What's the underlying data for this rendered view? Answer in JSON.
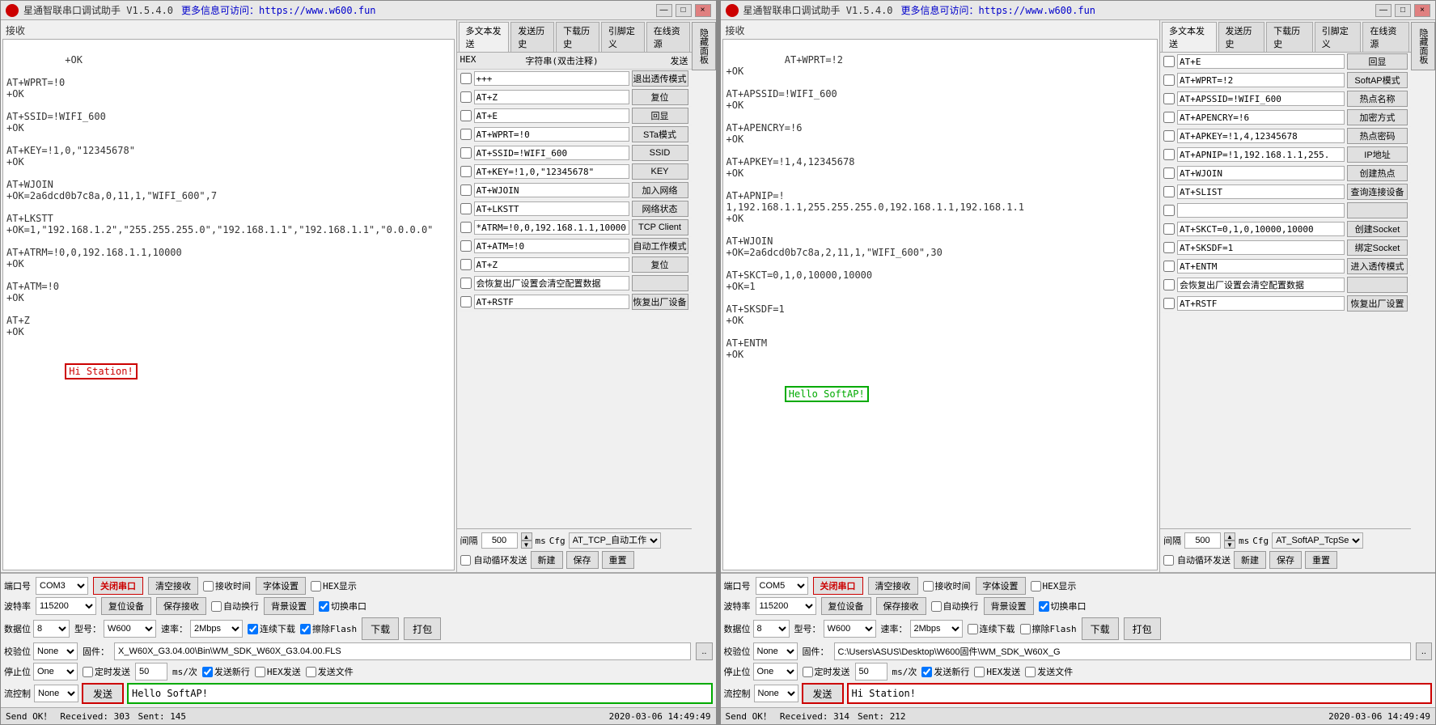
{
  "window1": {
    "title": "星通智联串口调试助手 V1.5.4.0",
    "url": "更多信息可访问：https://www.w600.fun",
    "controls": [
      "—",
      "□",
      "×"
    ],
    "receive_label": "接收",
    "receive_content": "+OK\n\nAT+WPRT=!0\n+OK\n\nAT+SSID=!WIFI_600\n+OK\n\nAT+KEY=!1,0,\"12345678\"\n+OK\n\nAT+WJOIN\n+OK=2a6dcd0b7c8a,0,11,1,\"WIFI_600\",7\n\nAT+LKSTT\n+OK=1,\"192.168.1.2\",\"255.255.255.0\",\"192.168.1.1\",\"192.168.1.1\",\"0.0.0.0\"\n\nAT+ATRM=!0,0,192.168.1.1,10000\n+OK\n\nAT+ATM=!0\n+OK\n\nAT+Z\n+OK",
    "hi_station": "Hi Station!",
    "tabs": [
      "多文本发送",
      "发送历史",
      "下载历史",
      "引脚定义",
      "在线资源"
    ],
    "multi_send": {
      "header": {
        "hex": "HEX",
        "str": "字符串(双击注释)",
        "send": "发送"
      },
      "rows": [
        {
          "hex": false,
          "value": "+++",
          "btn": "退出透传模式"
        },
        {
          "hex": false,
          "value": "AT+Z",
          "btn": "复位"
        },
        {
          "hex": false,
          "value": "AT+E",
          "btn": "回显"
        },
        {
          "hex": false,
          "value": "AT+WPRT=!0",
          "btn": "STa模式"
        },
        {
          "hex": false,
          "value": "AT+SSID=!WIFI_600",
          "btn": "SSID"
        },
        {
          "hex": false,
          "value": "AT+KEY=!1,0,\"12345678\"",
          "btn": "KEY"
        },
        {
          "hex": false,
          "value": "AT+WJOIN",
          "btn": "加入网络"
        },
        {
          "hex": false,
          "value": "AT+LKSTT",
          "btn": "网络状态"
        },
        {
          "hex": false,
          "value": "*ATRM=!0,0,192.168.1.1,10000",
          "btn": "TCP Client"
        },
        {
          "hex": false,
          "value": "AT+ATM=!0",
          "btn": "自动工作模式"
        },
        {
          "hex": false,
          "value": "AT+Z",
          "btn": "复位"
        },
        {
          "hex": false,
          "value": "会恢复出厂设置会清空配置数据",
          "btn": ""
        },
        {
          "hex": false,
          "value": "AT+RSTF",
          "btn": "恢复出厂设备"
        }
      ],
      "interval_label": "间隔",
      "interval_value": "500",
      "ms_label": "ms",
      "cfg_label": "Cfg",
      "cfg_value": "AT_TCP_自动工作",
      "autocycle_label": "自动循环发送",
      "btn_new": "新建",
      "btn_save": "保存",
      "btn_reset": "重置"
    },
    "bottom": {
      "port_label": "端口号",
      "port_value": "COM3",
      "close_btn": "关闭串口",
      "clear_recv_btn": "清空接收",
      "recv_time_label": "接收时间",
      "font_btn": "字体设置",
      "hex_display_label": "HEX显示",
      "hide_panel_btn": "隐藏面板",
      "baud_label": "波特率",
      "baud_value": "115200",
      "restore_btn": "复位设备",
      "save_recv_btn": "保存接收",
      "auto_newline_label": "自动换行",
      "bg_btn": "背景设置",
      "switch_label": "切换串口",
      "data_bits_label": "数据位",
      "data_bits_value": "8",
      "model_label": "型号：",
      "model_value": "W600",
      "speed_label": "速率：",
      "speed_value": "2Mbps",
      "continuous_dl_label": "连续下载",
      "erase_flash_label": "擦除Flash",
      "parity_label": "校验位",
      "parity_value": "None",
      "firmware_label": "固件：",
      "firmware_value": "X_W60X_G3.04.00\\Bin\\WM_SDK_W60X_G3.04.00.FLS",
      "browse_btn": "..",
      "download_btn": "下载",
      "pack_btn": "打包",
      "stop_bits_label": "停止位",
      "stop_bits_value": "One",
      "timed_send_label": "定时发送",
      "timed_value": "50",
      "ms_per_label": "ms/次",
      "send_newline_label": "发送新行",
      "hex_send_label": "HEX发送",
      "send_file_label": "发送文件",
      "flow_label": "流控制",
      "flow_value": "None",
      "send_btn": "发送",
      "send_input": "Hello SoftAP!",
      "status_left": "Send OK！",
      "status_received": "Received: 303",
      "status_sent": "Sent: 145",
      "status_time": "2020-03-06  14:49:49"
    }
  },
  "window2": {
    "title": "星通智联串口调试助手 V1.5.4.0",
    "url": "更多信息可访问：https://www.w600.fun",
    "controls": [
      "—",
      "□",
      "×"
    ],
    "receive_label": "接收",
    "receive_content": "AT+WPRT=!2\n+OK\n\nAT+APSSID=!WIFI_600\n+OK\n\nAT+APENCRY=!6\n+OK\n\nAT+APKEY=!1,4,12345678\n+OK\n\nAT+APNIP=!\n1,192.168.1.1,255.255.255.0,192.168.1.1,192.168.1.1\n+OK\n\nAT+WJOIN\n+OK=2a6dcd0b7c8a,2,11,1,\"WIFI_600\",30\n\nAT+SKCT=0,1,0,10000,10000\n+OK=1\n\nAT+SKSDF=1\n+OK\n\nAT+ENTM\n+OK",
    "hello_softap": "Hello SoftAP!",
    "tabs": [
      "多文本发送",
      "发送历史",
      "下载历史",
      "引脚定义",
      "在线资源"
    ],
    "right_list": {
      "rows": [
        {
          "hex": false,
          "value": "AT+E",
          "btn": "回显"
        },
        {
          "hex": false,
          "value": "AT+WPRT=!2",
          "btn": "SoftAP模式"
        },
        {
          "hex": false,
          "value": "AT+APSSID=!WIFI_600",
          "btn": "热点名称"
        },
        {
          "hex": false,
          "value": "AT+APENCRY=!6",
          "btn": "加密方式"
        },
        {
          "hex": false,
          "value": "AT+APKEY=!1,4,12345678",
          "btn": "热点密码"
        },
        {
          "hex": false,
          "value": "AT+APNIP=!1,192.168.1.1,255.",
          "btn": "IP地址"
        },
        {
          "hex": false,
          "value": "AT+WJOIN",
          "btn": "创建热点"
        },
        {
          "hex": false,
          "value": "AT+SLIST",
          "btn": "查询连接设备"
        },
        {
          "hex": false,
          "value": "",
          "btn": ""
        },
        {
          "hex": false,
          "value": "AT+SKCT=0,1,0,10000,10000",
          "btn": "创建Socket"
        },
        {
          "hex": false,
          "value": "AT+SKSDF=1",
          "btn": "绑定Socket"
        },
        {
          "hex": false,
          "value": "AT+ENTM",
          "btn": "进入透传模式"
        },
        {
          "hex": false,
          "value": "会恢复出厂设置会清空配置数据",
          "btn": ""
        },
        {
          "hex": false,
          "value": "AT+RSTF",
          "btn": "恢复出厂设置"
        }
      ]
    },
    "bottom": {
      "port_label": "端口号",
      "port_value": "COM5",
      "close_btn": "关闭串口",
      "clear_recv_btn": "清空接收",
      "recv_time_label": "接收时间",
      "font_btn": "字体设置",
      "hex_display_label": "HEX显示",
      "hide_panel_btn": "隐藏面板",
      "baud_label": "波特率",
      "baud_value": "115200",
      "restore_btn": "复位设备",
      "save_recv_btn": "保存接收",
      "auto_newline_label": "自动换行",
      "bg_btn": "背景设置",
      "switch_label": "切换串口",
      "data_bits_label": "数据位",
      "data_bits_value": "8",
      "model_label": "型号：",
      "model_value": "W600",
      "speed_label": "速率：",
      "speed_value": "2Mbps",
      "continuous_dl_label": "连续下载",
      "erase_flash_label": "擦除Flash",
      "parity_label": "校验位",
      "parity_value": "None",
      "firmware_label": "固件：",
      "firmware_value": "C:\\Users\\ASUS\\Desktop\\W600固件\\WM_SDK_W60X_G",
      "browse_btn": "..",
      "download_btn": "下载",
      "pack_btn": "打包",
      "stop_bits_label": "停止位",
      "stop_bits_value": "One",
      "timed_send_label": "定时发送",
      "timed_value": "50",
      "ms_per_label": "ms/次",
      "send_newline_label": "发送新行",
      "hex_send_label": "HEX发送",
      "send_file_label": "发送文件",
      "flow_label": "流控制",
      "flow_value": "None",
      "send_btn": "发送",
      "send_input": "Hi Station!",
      "status_left": "Send OK！",
      "status_received": "Received: 314",
      "status_sent": "Sent: 212",
      "status_time": "2020-03-06  14:49:49",
      "interval_value": "500",
      "cfg_value": "AT_SoftAP_TcpSe"
    }
  }
}
